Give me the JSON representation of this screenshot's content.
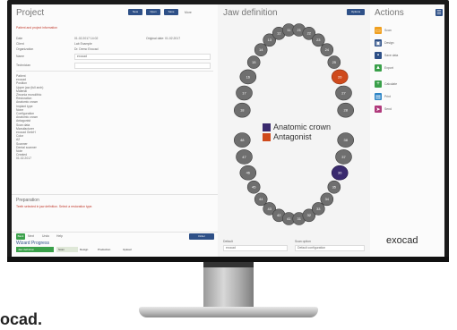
{
  "brand_text": "ocad.",
  "project": {
    "title": "Project",
    "toolbar": [
      "New",
      "Open",
      "Save",
      "More"
    ],
    "header_note": "Patient and project information",
    "rows": [
      {
        "label": "Date",
        "value": "01.02.2017 14:02",
        "extra": "Original date: 01.02.2017"
      },
      {
        "label": "Client",
        "value": "Lab Example"
      },
      {
        "label": "Organization",
        "value": "Dr. Demo Exocad"
      }
    ],
    "selects": [
      {
        "label": "Name",
        "value": "exocad"
      },
      {
        "label": "Technician",
        "value": ""
      }
    ],
    "detail_lines": [
      "Patient",
      "exocad",
      "Position",
      "Upper jaw (full arch)",
      "Material",
      "Zirconia monolithic",
      "Restoration",
      "Anatomic crown",
      "Implant type",
      "None",
      "Configuration",
      "Anatomic crown",
      "Antagonist",
      "Scan data",
      "Manufacturer",
      "exocad GmbH",
      "Color",
      "A2",
      "Scanner",
      "Dental scanner",
      "Note",
      "",
      "Further information",
      "",
      "Created",
      "01.02.2017"
    ],
    "prep_title": "Preparation",
    "prep_note": "Teeth selected in jaw definition. Select a restoration type.",
    "bottom_controls": [
      "Back",
      "Next",
      "Undo",
      "Help"
    ],
    "bottom_right_btn": "Order",
    "wizard_title": "Wizard Progress",
    "wizard_steps": [
      "Jaw definition",
      "Scan",
      "Design",
      "Production",
      "Upload"
    ]
  },
  "jaw": {
    "title": "Jaw definition",
    "top_btn": "Options",
    "legend": [
      {
        "label": "Anatomic crown",
        "color": "#3a2a6e"
      },
      {
        "label": "Antagonist",
        "color": "#cf4a1c"
      }
    ],
    "upper_numbers": [
      "18",
      "17",
      "16",
      "15",
      "14",
      "13",
      "12",
      "11",
      "21",
      "22",
      "23",
      "24",
      "25",
      "26",
      "27",
      "28"
    ],
    "lower_numbers": [
      "48",
      "47",
      "46",
      "45",
      "44",
      "43",
      "42",
      "41",
      "31",
      "32",
      "33",
      "34",
      "35",
      "36",
      "37",
      "38"
    ],
    "bottom_left_label": "Default",
    "bottom_right_label": "Scan option",
    "bottom_left_value": "exocad",
    "bottom_right_value": "Default configuration"
  },
  "actions": {
    "title": "Actions",
    "top_icon": "menu-icon",
    "items": [
      {
        "label": "Scan",
        "color": "#f0a020",
        "icon": "folder-icon"
      },
      {
        "label": "Design",
        "color": "#2e5087",
        "icon": "monitor-icon"
      },
      {
        "label": "Save data",
        "color": "#2e5087",
        "icon": "save-icon"
      },
      {
        "label": "Export",
        "color": "#3aa04a",
        "icon": "export-icon"
      },
      {
        "label": "Calculate",
        "color": "#3aa04a",
        "icon": "plus-icon"
      },
      {
        "label": "Print",
        "color": "#2e85c6",
        "icon": "print-icon"
      },
      {
        "label": "Send",
        "color": "#b03a7c",
        "icon": "send-icon"
      }
    ],
    "logo": "exocad"
  },
  "colors": {
    "accent": "#2e5087",
    "green": "#3aa04a",
    "crown": "#3a2a6e",
    "antagonist": "#cf4a1c"
  }
}
